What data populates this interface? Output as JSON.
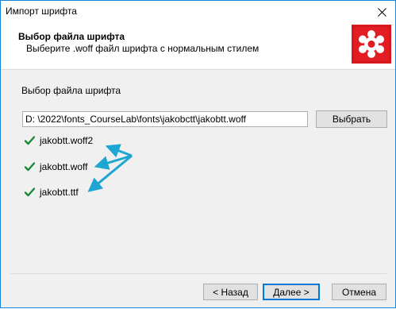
{
  "window": {
    "title": "Импорт шрифта"
  },
  "header": {
    "title": "Выбор файла шрифта",
    "subtitle": "Выберите .woff файл шрифта с нормальным стилем"
  },
  "main": {
    "section_label": "Выбор файла шрифта",
    "path_value": "D: \\2022\\fonts_CourseLab\\fonts\\jakobctt\\jakobtt.woff",
    "browse_label": "Выбрать",
    "files": [
      {
        "name": "jakobtt.woff2",
        "status": "ok"
      },
      {
        "name": "jakobtt.woff",
        "status": "ok"
      },
      {
        "name": "jakobtt.ttf",
        "status": "ok"
      }
    ]
  },
  "footer": {
    "back_label": "< Назад",
    "next_label": "Далее >",
    "cancel_label": "Отмена"
  },
  "colors": {
    "check": "#1a8a3a",
    "arrow": "#1ea6d2",
    "logo_bg": "#e31b23",
    "window_border": "#1883d7"
  },
  "icons": {
    "close": "close-icon",
    "logo": "app-logo-icon",
    "check": "checkmark-icon"
  }
}
